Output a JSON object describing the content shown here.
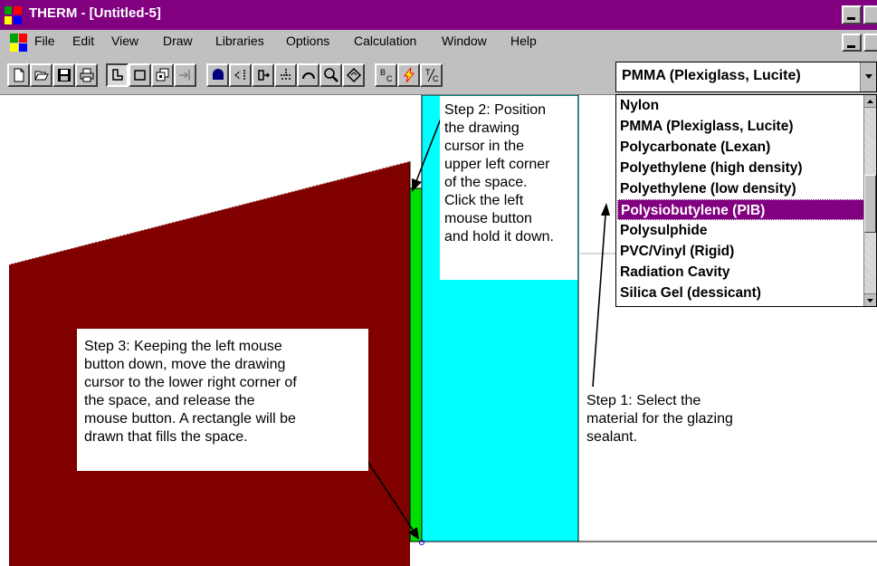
{
  "window": {
    "title": "THERM - [Untitled-5]"
  },
  "menu": [
    {
      "label": "File"
    },
    {
      "label": "Edit"
    },
    {
      "label": "View"
    },
    {
      "label": "Draw"
    },
    {
      "label": "Libraries"
    },
    {
      "label": "Options"
    },
    {
      "label": "Calculation"
    },
    {
      "label": "Window"
    },
    {
      "label": "Help"
    }
  ],
  "toolbar": {
    "buttons": [
      "new-file-icon",
      "open-folder-icon",
      "save-disk-icon",
      "print-icon",
      "draw-polygon-icon",
      "draw-rectangle-icon",
      "fill-cavity-icon",
      "locator-icon",
      "boundary-icon",
      "insert-point-icon",
      "offset-icon",
      "snap-icon",
      "arc-icon",
      "zoom-icon",
      "rotate-icon",
      "boundary-conditions-icon",
      "calculate-icon",
      "temperature-icon"
    ],
    "bc_label": "B",
    "bc_sub": "C",
    "tc_label": "T",
    "tc_sub": "C"
  },
  "material_select": {
    "selected": "PMMA (Plexiglass, Lucite)",
    "options": [
      "Nylon",
      "PMMA (Plexiglass, Lucite)",
      "Polycarbonate (Lexan)",
      "Polyethylene (high density)",
      "Polyethylene (low density)",
      "Polysiobutylene (PIB)",
      "Polysulphide",
      "PVC/Vinyl (Rigid)",
      "Radiation Cavity",
      "Silica Gel (dessicant)"
    ],
    "highlighted": "Polysiobutylene (PIB)"
  },
  "colors": {
    "title_bar": "#800080",
    "frame": "#800000",
    "sealant": "#00e000",
    "glass": "#00ffff",
    "highlight": "#800080"
  },
  "callouts": {
    "step1": [
      "Step 1: Select the",
      "material for the glazing",
      "sealant."
    ],
    "step2": [
      "Step 2: Position",
      "the drawing",
      "cursor in the",
      "upper left corner",
      "of the space.",
      "Click the left",
      "mouse button",
      "and hold it down."
    ],
    "step3": [
      "Step 3: Keeping the left mouse",
      "button down, move the drawing",
      "cursor to the lower right corner of",
      "the space, and release the",
      "mouse button. A rectangle will be",
      "drawn that fills the space."
    ]
  }
}
